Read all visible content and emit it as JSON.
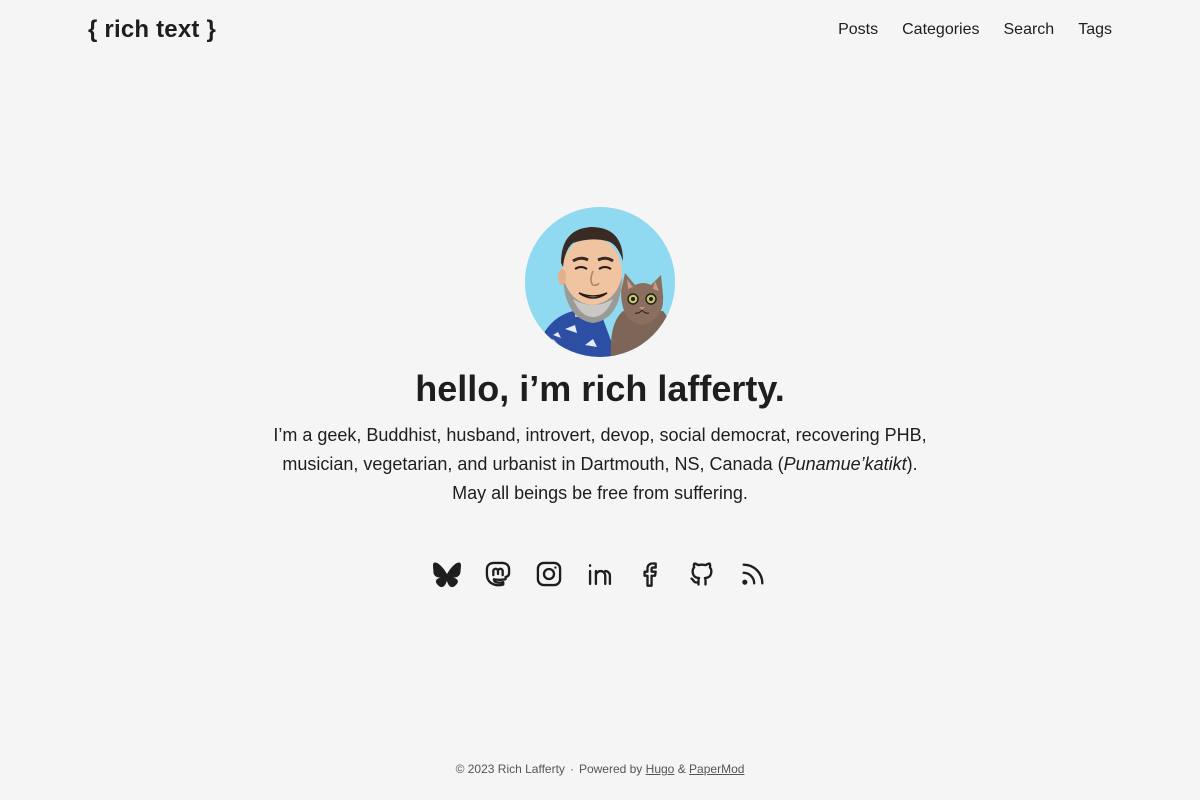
{
  "header": {
    "logo": "{ rich text }",
    "menu": [
      "Posts",
      "Categories",
      "Search",
      "Tags"
    ]
  },
  "profile": {
    "avatar_alt": "avatar",
    "title": "hello, i’m rich lafferty.",
    "bio_part1": "I’m a geek, Buddhist, husband, introvert, devop, social democrat, recovering PHB, musician, vegetarian, and urbanist in Dartmouth, NS, Canada (",
    "bio_italic": "Punamue’katikt",
    "bio_part2": ").",
    "bio_line3": "May all beings be free from suffering."
  },
  "social": {
    "icons": [
      "bluesky-icon",
      "mastodon-icon",
      "instagram-icon",
      "linkedin-icon",
      "facebook-icon",
      "github-icon",
      "rss-icon"
    ]
  },
  "footer": {
    "copyright": "© 2023 Rich Lafferty",
    "separator": "·",
    "powered_by": "Powered by",
    "hugo": "Hugo",
    "amp": "&",
    "papermod": "PaperMod"
  },
  "colors": {
    "background": "#f5f5f5",
    "text": "#1e1e1e",
    "footer_text": "#555555",
    "avatar_bg": "#8fdaf1"
  }
}
